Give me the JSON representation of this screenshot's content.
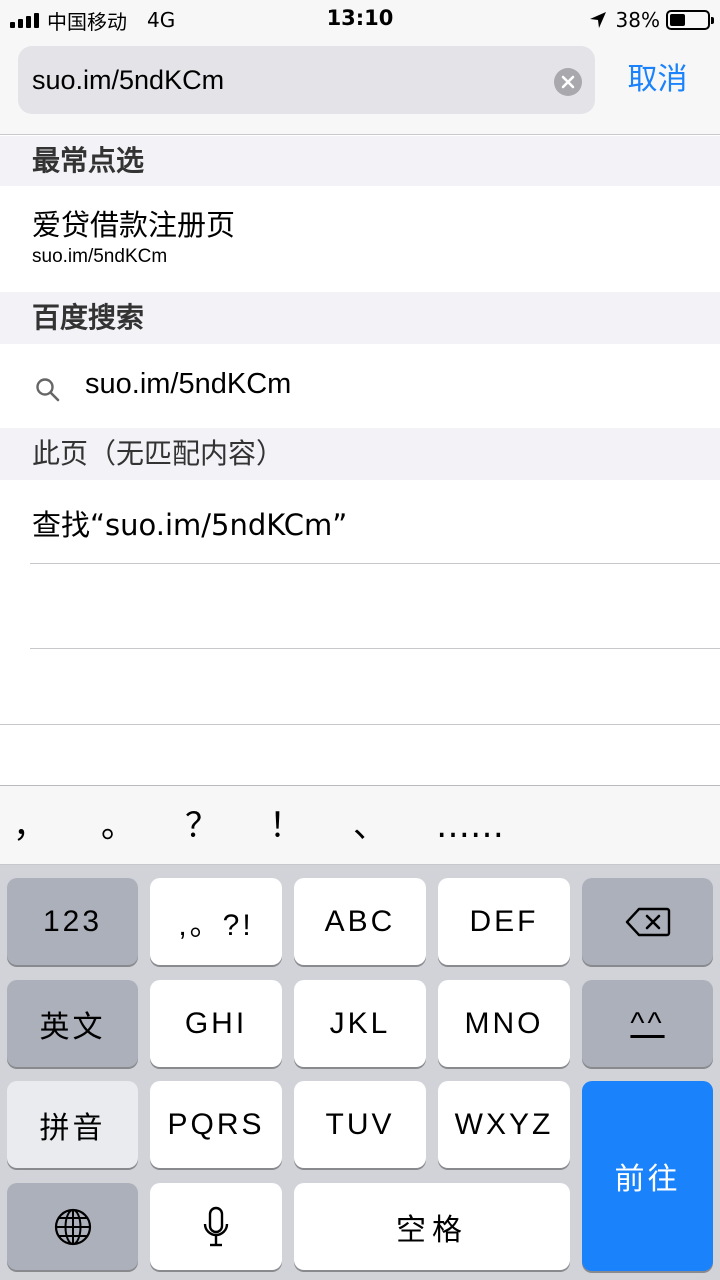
{
  "status_bar": {
    "carrier": "中国移动",
    "network": "4G",
    "time": "13:10",
    "battery": "38%"
  },
  "search": {
    "value": "suo.im/5ndKCm",
    "cancel_label": "取消"
  },
  "sections": {
    "top_hits": {
      "header": "最常点选",
      "item_title": "爱贷借款注册页",
      "item_url": "suo.im/5ndKCm"
    },
    "baidu": {
      "header": "百度搜索",
      "query": "suo.im/5ndKCm"
    },
    "on_page": {
      "header": "此页（无匹配内容）",
      "find_label": "查找“suo.im/5ndKCm”"
    }
  },
  "keyboard": {
    "candidates": [
      "，",
      "。",
      "？",
      "！",
      "、",
      "……"
    ],
    "keys": {
      "num": "123",
      "punct": ",。?!",
      "abc": "ABC",
      "def": "DEF",
      "english": "英文",
      "ghi": "GHI",
      "jkl": "JKL",
      "mno": "MNO",
      "emoticon": "^^",
      "pinyin": "拼音",
      "pqrs": "PQRS",
      "tuv": "TUV",
      "wxyz": "WXYZ",
      "go": "前往",
      "space": "空格"
    }
  },
  "colors": {
    "accent": "#1a82fb",
    "keyboard_bg": "#d1d3d9",
    "function_key": "#acb0ba"
  },
  "icons": [
    "signal-icon",
    "location-arrow-icon",
    "battery-icon",
    "clear-icon",
    "search-icon",
    "backspace-icon",
    "globe-icon",
    "microphone-icon"
  ]
}
